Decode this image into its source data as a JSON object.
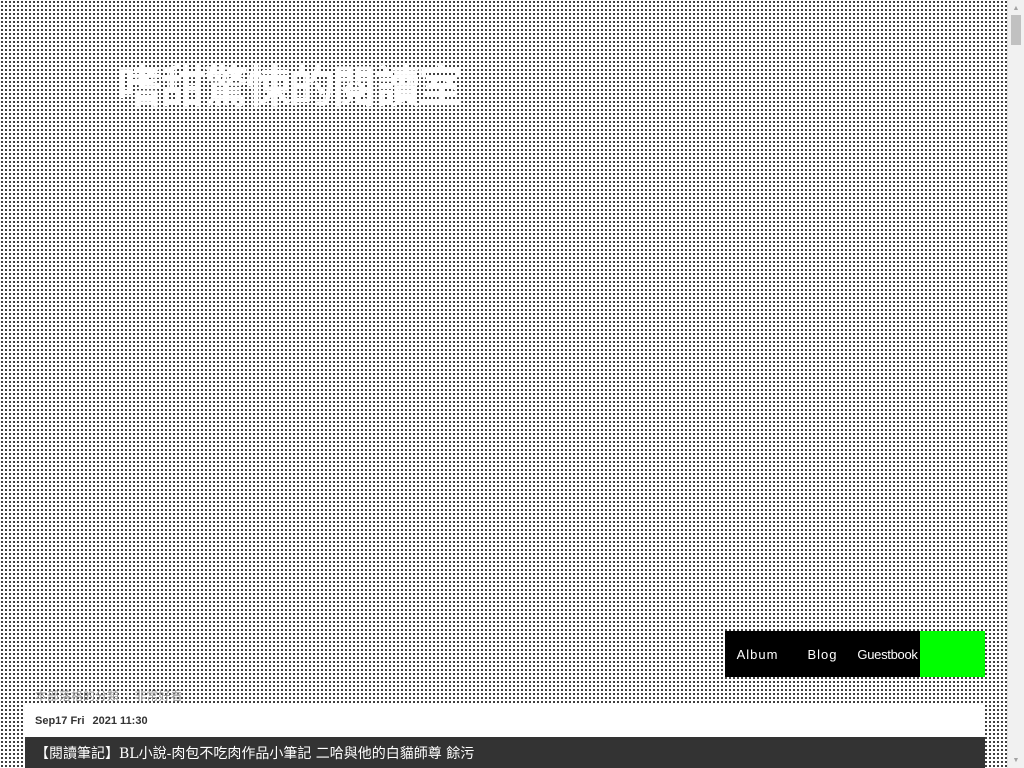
{
  "header": {
    "blog_title": "嗜甜驚悚的閱讀室"
  },
  "nav": {
    "items": [
      {
        "label": "Album"
      },
      {
        "label": "Blog"
      },
      {
        "label": "Guestbook"
      }
    ],
    "accent_color": "#00ff00"
  },
  "breadcrumb": {
    "section": "本部落格的分類",
    "separator": ":",
    "category": "非常好看"
  },
  "post": {
    "date": "Sep17 Fri",
    "time": "2021 11:30",
    "title": "【閱讀筆記】BL小說-肉包不吃肉作品小筆記 二哈與他的白貓師尊 餘污"
  },
  "scrollbar": {
    "up_icon": "▲",
    "down_icon": "▼"
  }
}
